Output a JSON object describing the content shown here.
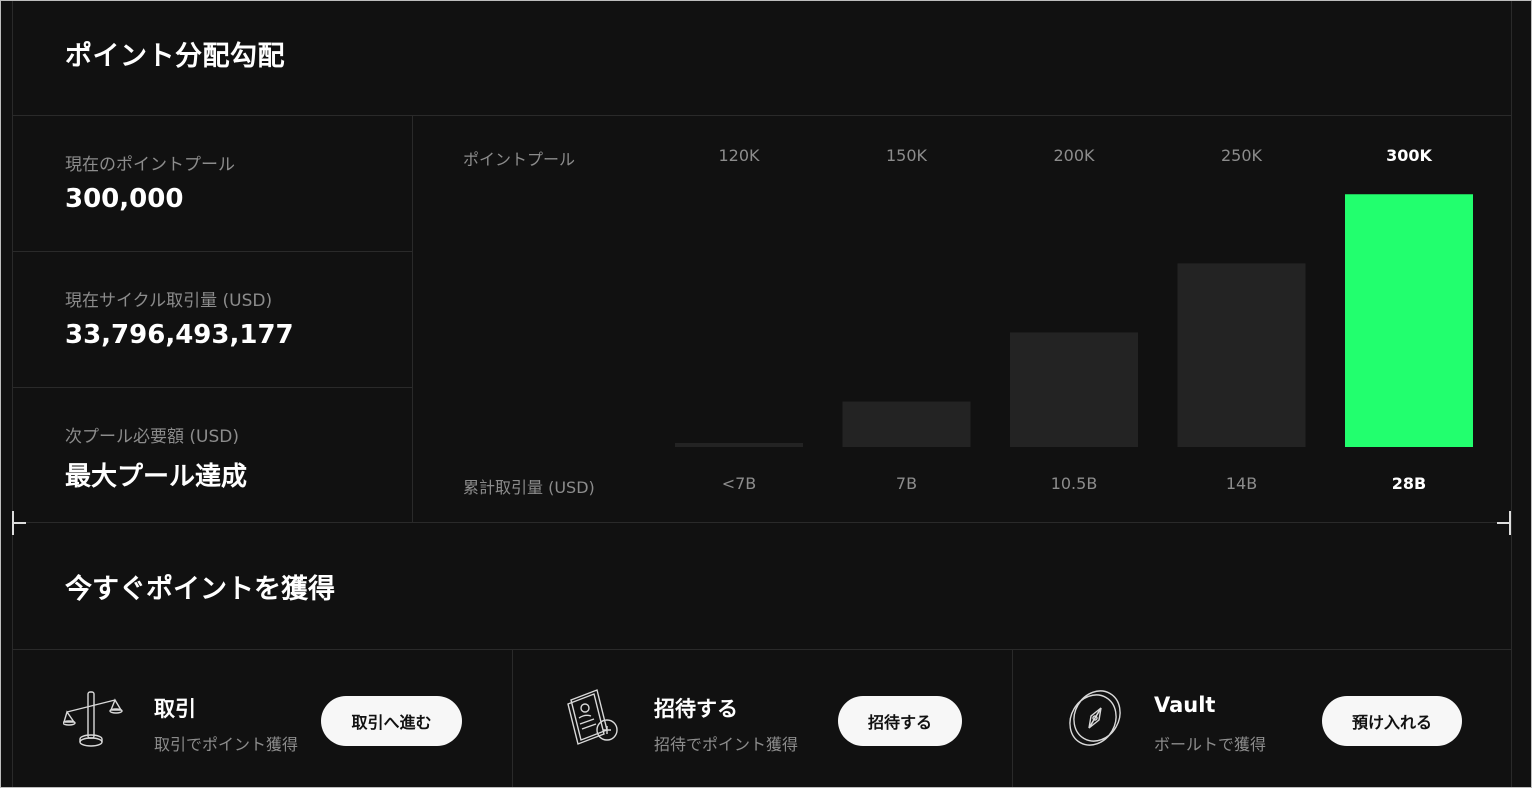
{
  "header": {
    "title": "ポイント分配勾配"
  },
  "stats": [
    {
      "label": "現在のポイントプール",
      "value": "300,000"
    },
    {
      "label": "現在サイクル取引量 (USD)",
      "value": "33,796,493,177"
    },
    {
      "label": "次プール必要額 (USD)",
      "value": "最大プール達成"
    }
  ],
  "chart_data": {
    "type": "bar",
    "row_label_top": "ポイントプール",
    "row_label_bottom": "累計取引量 (USD)",
    "pool_labels": [
      "120K",
      "150K",
      "200K",
      "250K",
      "300K"
    ],
    "categories": [
      "<7B",
      "7B",
      "10.5B",
      "14B",
      "28B"
    ],
    "values": [
      120000,
      150000,
      200000,
      250000,
      300000
    ],
    "active_index": 4,
    "colors": {
      "active": "#22ff6e",
      "inactive": "#232323"
    }
  },
  "earn": {
    "title": "今すぐポイントを獲得",
    "cards": [
      {
        "icon": "scale-icon",
        "name": "取引",
        "desc": "取引でポイント獲得",
        "button": "取引へ進む"
      },
      {
        "icon": "invite-card-icon",
        "name": "招待する",
        "desc": "招待でポイント獲得",
        "button": "招待する"
      },
      {
        "icon": "compass-icon",
        "name": "Vault",
        "desc": "ボールトで獲得",
        "button": "預け入れる"
      }
    ]
  }
}
